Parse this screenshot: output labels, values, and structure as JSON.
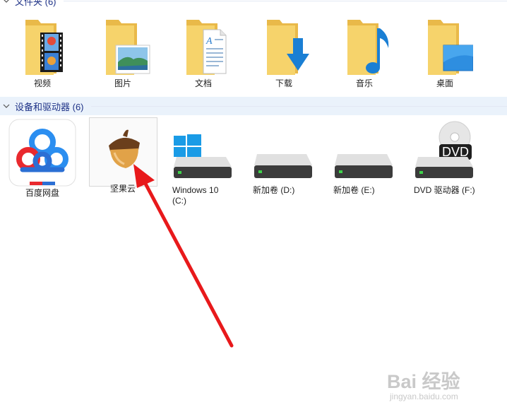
{
  "sections": {
    "folders": {
      "title": "文件夹 (6)"
    },
    "devices": {
      "title": "设备和驱动器 (6)"
    }
  },
  "folders": [
    {
      "label": "视频",
      "icon": "video-folder-icon"
    },
    {
      "label": "图片",
      "icon": "pictures-folder-icon"
    },
    {
      "label": "文档",
      "icon": "documents-folder-icon"
    },
    {
      "label": "下载",
      "icon": "downloads-folder-icon"
    },
    {
      "label": "音乐",
      "icon": "music-folder-icon"
    },
    {
      "label": "桌面",
      "icon": "desktop-folder-icon"
    }
  ],
  "devices": [
    {
      "label": "百度网盘",
      "icon": "baidu-netdisk-icon"
    },
    {
      "label": "坚果云",
      "icon": "nutstore-acorn-icon"
    },
    {
      "label": "Windows 10",
      "label2": "(C:)",
      "icon": "windows-drive-icon"
    },
    {
      "label": "新加卷 (D:)",
      "icon": "hard-drive-icon"
    },
    {
      "label": "新加卷 (E:)",
      "icon": "hard-drive-icon"
    },
    {
      "label": "DVD 驱动器 (F:)",
      "badge": "DVD",
      "icon": "dvd-drive-icon"
    }
  ],
  "watermark": {
    "main": "Bai 经验",
    "sub": "jingyan.baidu.com"
  },
  "colors": {
    "folder": "#f6d36b",
    "accent_blue": "#1a7fd4",
    "arrow_red": "#e8191b",
    "header_text": "#1e3287"
  }
}
